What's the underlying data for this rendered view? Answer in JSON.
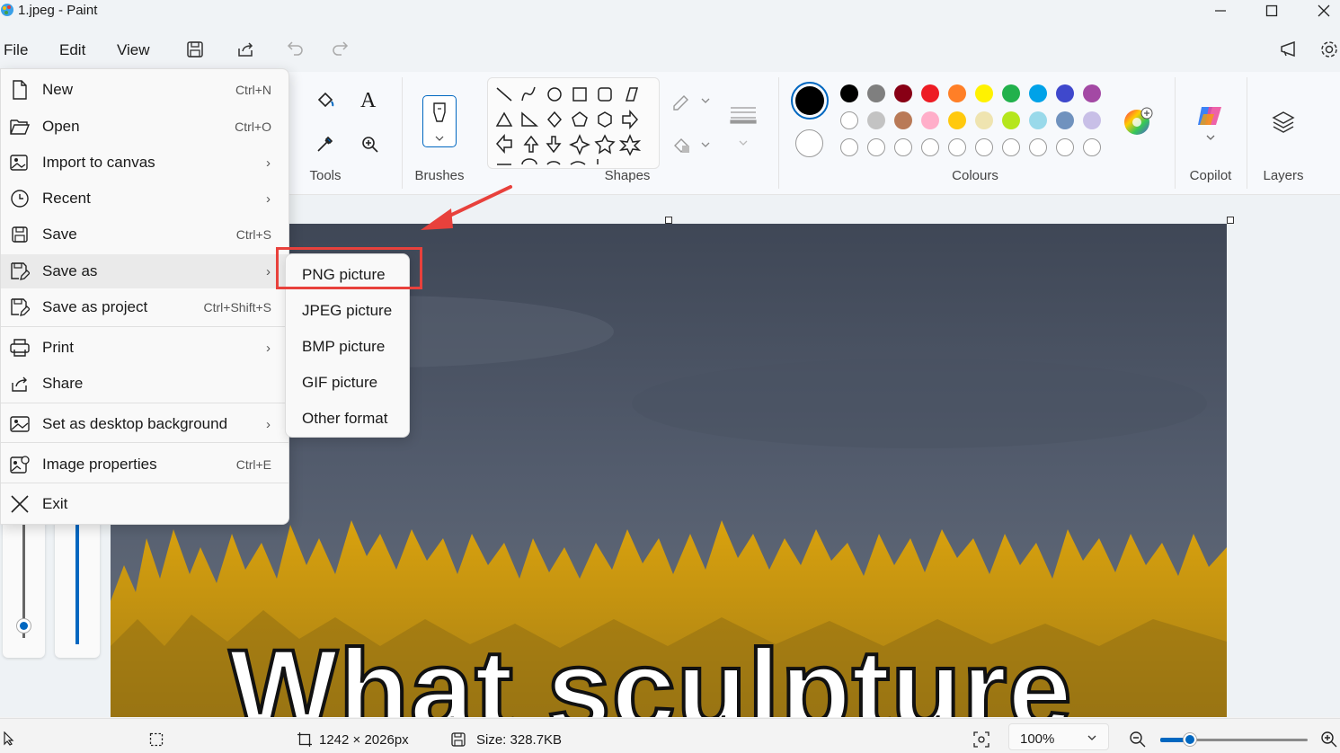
{
  "window": {
    "title": "1.jpeg - Paint"
  },
  "menubar": {
    "file": "File",
    "edit": "Edit",
    "view": "View"
  },
  "ribbon": {
    "tools_label": "Tools",
    "brushes_label": "Brushes",
    "shapes_label": "Shapes",
    "colours_label": "Colours",
    "copilot_label": "Copilot",
    "layers_label": "Layers",
    "text_tool_glyph": "A",
    "palette": {
      "row1": [
        "#000000",
        "#7f7f7f",
        "#880015",
        "#ed1c24",
        "#ff7f27",
        "#fff200",
        "#22b14c",
        "#00a2e8",
        "#3f48cc",
        "#a349a4"
      ],
      "row2": [
        "#ffffff",
        "#c3c3c3",
        "#b97a57",
        "#ffaec9",
        "#ffc90e",
        "#efe4b0",
        "#b5e61d",
        "#99d9ea",
        "#7092be",
        "#c8bfe7"
      ]
    },
    "primary_color": "#000000",
    "secondary_color": "#ffffff"
  },
  "file_menu": {
    "items": [
      {
        "label": "New",
        "shortcut": "Ctrl+N"
      },
      {
        "label": "Open",
        "shortcut": "Ctrl+O"
      },
      {
        "label": "Import to canvas",
        "shortcut": ""
      },
      {
        "label": "Recent",
        "shortcut": ""
      },
      {
        "label": "Save",
        "shortcut": "Ctrl+S"
      },
      {
        "label": "Save as",
        "shortcut": ""
      },
      {
        "label": "Save as project",
        "shortcut": "Ctrl+Shift+S"
      },
      {
        "label": "Print",
        "shortcut": ""
      },
      {
        "label": "Share",
        "shortcut": ""
      },
      {
        "label": "Set as desktop background",
        "shortcut": ""
      },
      {
        "label": "Image properties",
        "shortcut": "Ctrl+E"
      },
      {
        "label": "Exit",
        "shortcut": ""
      }
    ]
  },
  "save_as_submenu": {
    "items": [
      "PNG picture",
      "JPEG picture",
      "BMP picture",
      "GIF picture",
      "Other format"
    ]
  },
  "canvas": {
    "overlay_text": "What sculpture"
  },
  "statusbar": {
    "dimensions": "1242 × 2026px",
    "size": "Size: 328.7KB",
    "zoom": "100%",
    "zoom_level": 0.17
  },
  "colors": {
    "accent": "#0067c0",
    "highlight": "#e8413c"
  }
}
